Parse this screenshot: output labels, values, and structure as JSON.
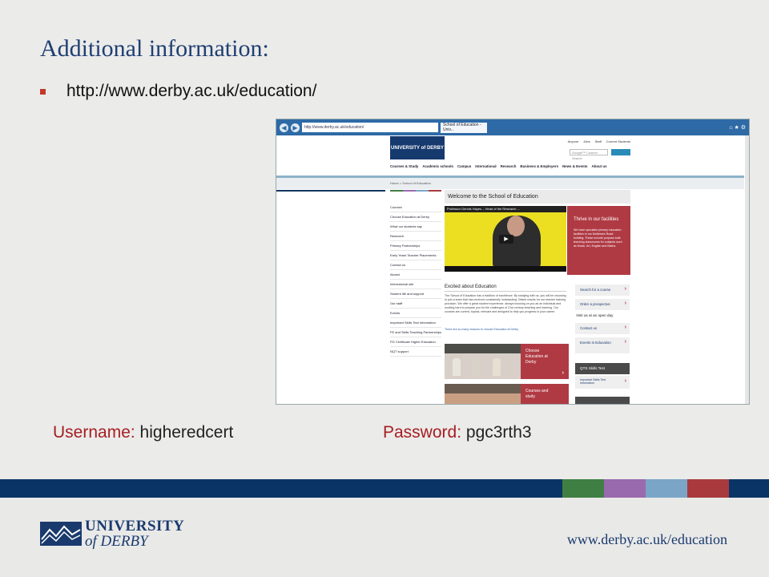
{
  "slide": {
    "title": "Additional information:",
    "url": "http://www.derby.ac.uk/education/",
    "username_label": "Username:",
    "username_value": "higheredcert",
    "password_label": "Password:",
    "password_value": "pgc3rth3",
    "logo_line1": "UNIVERSITY",
    "logo_line2": "of DERBY",
    "footer_url": "www.derby.ac.uk/education",
    "band_colors": [
      "#3f7f43",
      "#9a6aae",
      "#7ba5c7",
      "#a83a3d"
    ]
  },
  "browser": {
    "address": "http://www.derby.ac.uk/education/",
    "tab_title": "School of Education - Univ...",
    "site": {
      "logo": "UNIVERSITY of DERBY",
      "top_links": [
        "Anyone",
        "Jobs",
        "Staff",
        "Current Students"
      ],
      "search_placeholder": "Google™ Custom Search",
      "nav": [
        "Courses & Study",
        "Academic schools",
        "Campus",
        "International",
        "Research",
        "Business & Employers",
        "News & Events",
        "About us"
      ],
      "breadcrumb": "Home > School of Education",
      "side_nav": [
        "Courses",
        "Choose Education at Derby",
        "What our students say",
        "Research",
        "Primary Partnerships",
        "Early Years Teacher Placements",
        "Contact us",
        "Alumni",
        "International site",
        "Student life and support",
        "Our staff",
        "Events",
        "Important Skills Test Information",
        "FE and Skills Teaching Partnerships",
        "PG Certificate Higher Education",
        "NQT support"
      ],
      "welcome_title": "Welcome to the School of Education",
      "video_title": "Professor Dennis Hayes – Head of the Research ...",
      "thrive_title": "Thrive in our facilities",
      "thrive_text": "We have specialist primary education facilities in our Kedleston Road building. These include purpose-built teaching classrooms for subjects such as Music, Art, English and Maths.",
      "excited_title": "Excited about Education",
      "excited_body": "The School of Education has a tradition of excellence. By studying with us, you will be choosing to join a team that has received consistently 'outstanding' Ofsted results for our teacher training provision. We offer a great student experience, always focusing on you as an individual and working hard to prepare you for the challenges of 21st century teaching and learning. Our courses are current, topical, relevant and designed to help you progress in your career.",
      "excited_link": "There are so many reasons to choose Education at Derby",
      "cta": [
        "Search for a course",
        "Order a prospectus",
        "Contact us",
        "Events in Education"
      ],
      "open_day": "Visit us at an open day",
      "qts_title": "QTS Skills Test",
      "qts_item": "Important Skills Test Information",
      "red_cta_1": "Choose Education at Derby",
      "red_cta_2": "Courses and study"
    }
  }
}
